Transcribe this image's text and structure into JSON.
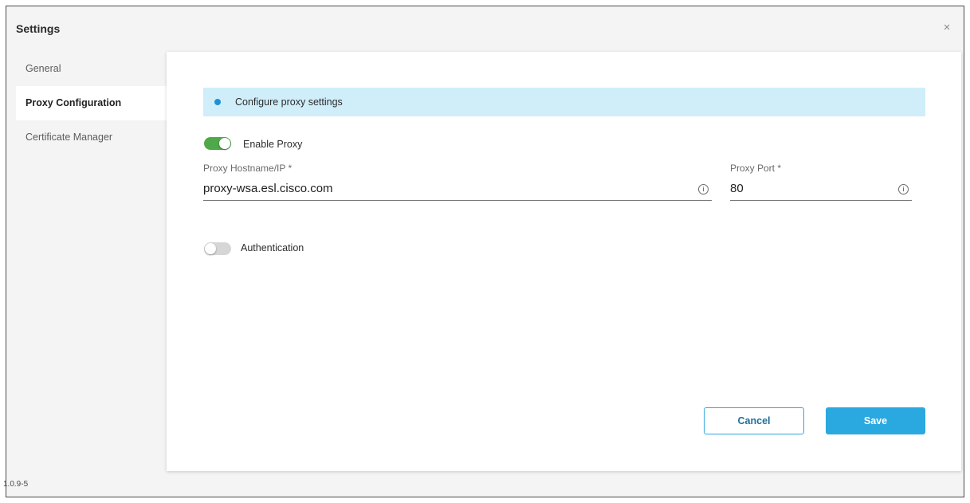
{
  "dialog": {
    "title": "Settings",
    "close_glyph": "×",
    "version": "1.0.9-5"
  },
  "sidebar": {
    "items": [
      {
        "label": "General",
        "active": false
      },
      {
        "label": "Proxy Configuration",
        "active": true
      },
      {
        "label": "Certificate Manager",
        "active": false
      }
    ]
  },
  "proxy": {
    "banner_text": "Configure proxy settings",
    "banner_icon": "info-dot-icon",
    "enable_proxy": {
      "label": "Enable Proxy",
      "enabled": true
    },
    "hostname": {
      "label": "Proxy Hostname/IP *",
      "value": "proxy-wsa.esl.cisco.com",
      "info_icon": "info-circle-icon"
    },
    "port": {
      "label": "Proxy Port *",
      "value": "80",
      "info_icon": "info-circle-icon"
    },
    "authentication": {
      "label": "Authentication",
      "enabled": false
    }
  },
  "actions": {
    "cancel_label": "Cancel",
    "save_label": "Save"
  },
  "colors": {
    "accent": "#2aa8e0",
    "toggle_on": "#4fa84a",
    "banner_bg": "#cfeefa"
  }
}
